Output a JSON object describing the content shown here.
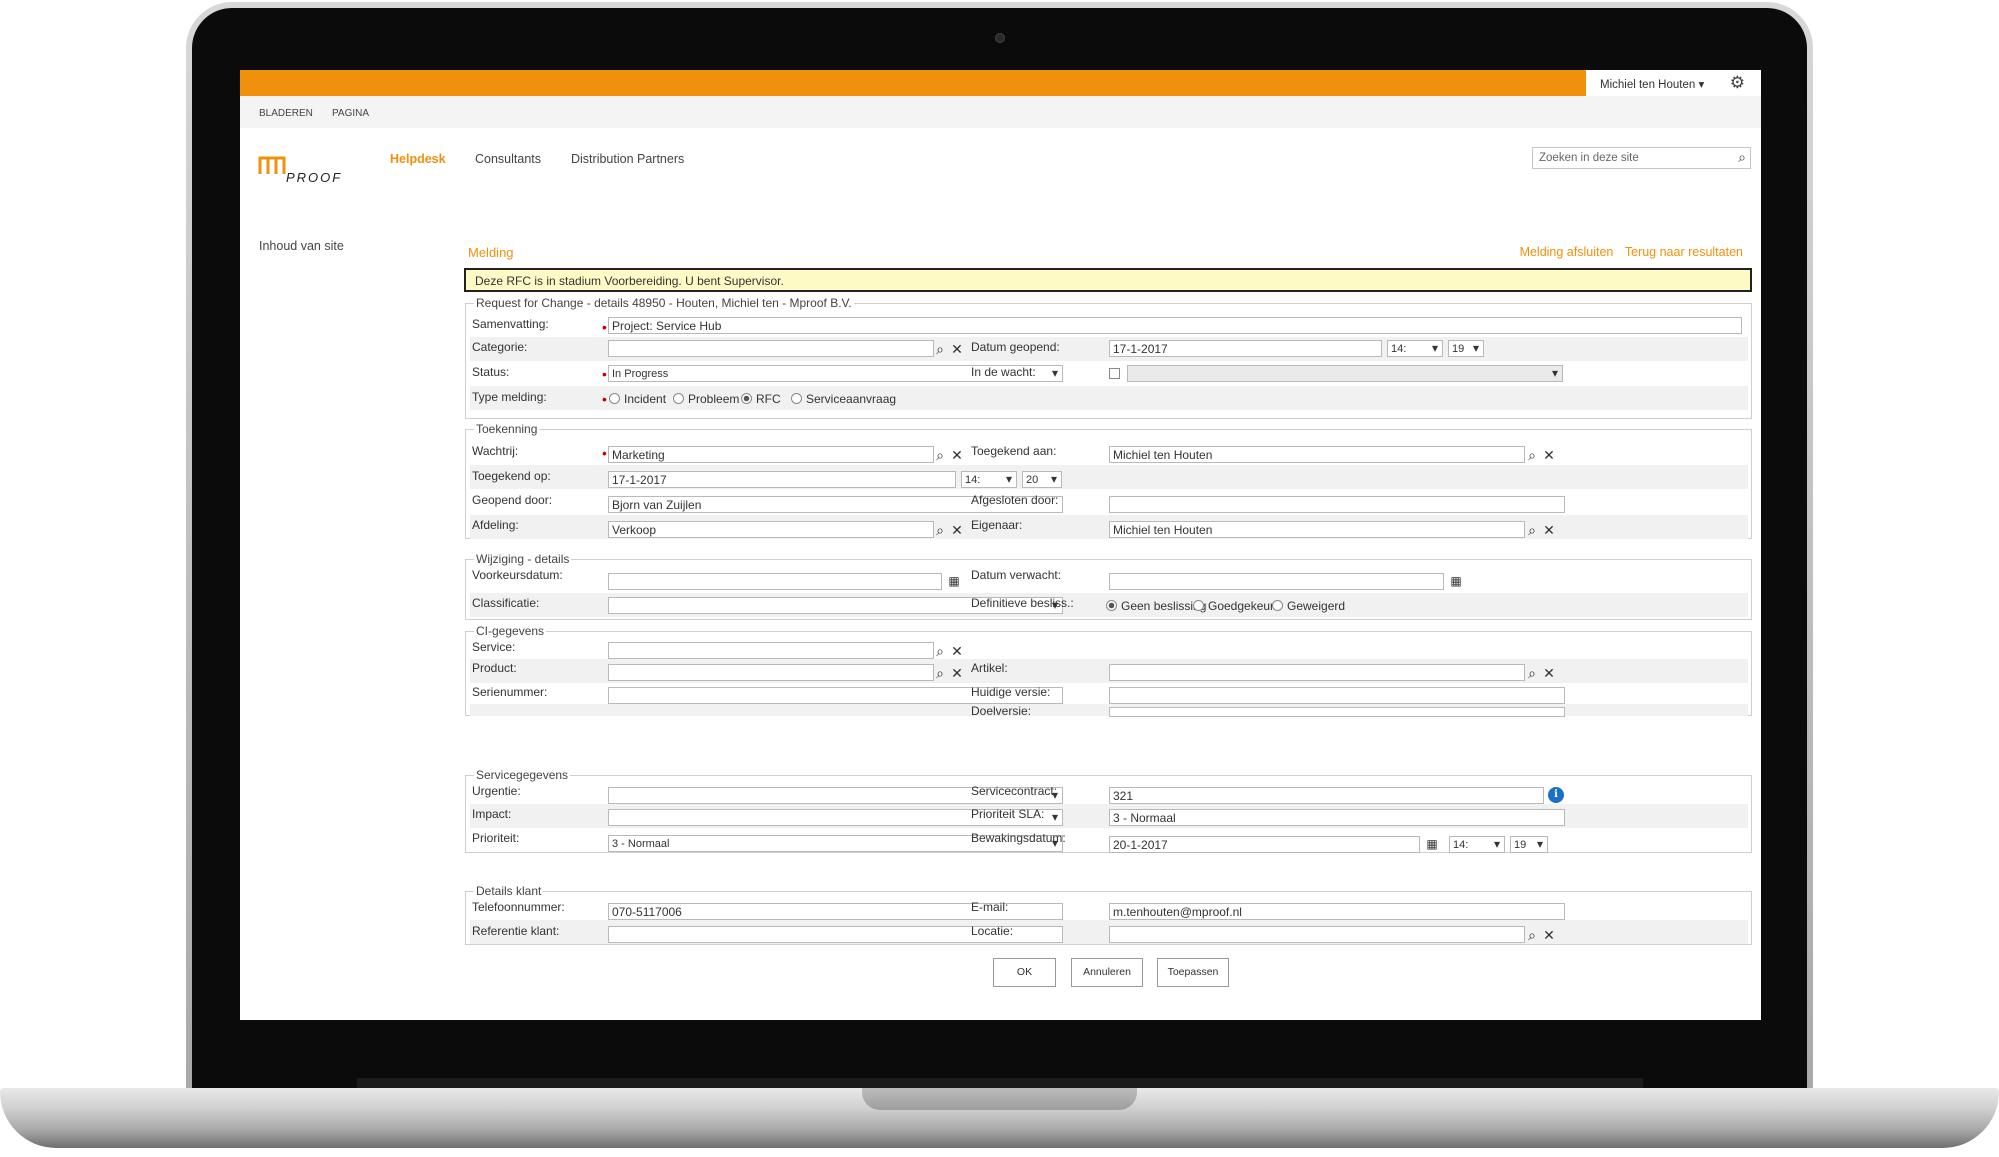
{
  "colors": {
    "accent": "#f0910e",
    "alert_bg": "#fefac6"
  },
  "header": {
    "user": "Michiel ten Houten",
    "user_caret": "▾",
    "gear_icon": "gear-icon",
    "search_placeholder": "Zoeken in deze site"
  },
  "ribbon": {
    "tab1": "BLADEREN",
    "tab2": "PAGINA"
  },
  "nav": {
    "helpdesk": "Helpdesk",
    "consultants": "Consultants",
    "partners": "Distribution Partners"
  },
  "logo": {
    "text": "PROOF"
  },
  "leftnav": {
    "site_contents": "Inhoud van site"
  },
  "page": {
    "breadcrumb": "Melding",
    "close_link": "Melding afsluiten",
    "back_link": "Terug naar resultaten",
    "alert": "Deze RFC is in stadium Voorbereiding. U bent Supervisor."
  },
  "s1": {
    "legend": "Request for Change - details 48950 - Houten, Michiel ten - Mproof B.V.",
    "samenvatting_label": "Samenvatting:",
    "samenvatting": "Project: Service Hub",
    "categorie_label": "Categorie:",
    "categorie": "",
    "datum_label": "Datum geopend:",
    "datum": "17-1-2017",
    "datum_h": "14:",
    "datum_m": "19",
    "status_label": "Status:",
    "status": "In Progress",
    "wacht_label": "In de wacht:",
    "wacht": "",
    "type_label": "Type melding:",
    "types": [
      "Incident",
      "Probleem",
      "RFC",
      "Serviceaanvraag"
    ]
  },
  "s2": {
    "legend": "Toekenning",
    "wachtrij_label": "Wachtrij:",
    "wachtrij": "Marketing",
    "toegekend_aan_label": "Toegekend aan:",
    "toegekend_aan": "Michiel ten Houten",
    "toegekend_op_label": "Toegekend op:",
    "toegekend_op": "17-1-2017",
    "toegekend_h": "14:",
    "toegekend_m": "20",
    "geopend_door_label": "Geopend door:",
    "geopend_door": "Bjorn van Zuijlen",
    "afgesloten_label": "Afgesloten door:",
    "afgesloten": "",
    "afdeling_label": "Afdeling:",
    "afdeling": "Verkoop",
    "eigenaar_label": "Eigenaar:",
    "eigenaar": "Michiel ten Houten"
  },
  "s3": {
    "legend": "Wijziging - details",
    "voorkeur_label": "Voorkeursdatum:",
    "verwacht_label": "Datum verwacht:",
    "classificatie_label": "Classificatie:",
    "besliss_label": "Definitieve besliss.:",
    "beslissingen": [
      "Geen beslissing",
      "Goedgekeurd",
      "Geweigerd"
    ]
  },
  "s4": {
    "legend": "CI-gegevens",
    "service_label": "Service:",
    "product_label": "Product:",
    "artikel_label": "Artikel:",
    "serie_label": "Serienummer:",
    "huidige_label": "Huidige versie:",
    "doel_label": "Doelversie:"
  },
  "s5": {
    "legend": "Servicegegevens",
    "urgentie_label": "Urgentie:",
    "contract_label": "Servicecontract:",
    "contract": "321",
    "impact_label": "Impact:",
    "sla_label": "Prioriteit SLA:",
    "sla": "3 - Normaal",
    "prioriteit_label": "Prioriteit:",
    "prioriteit": "3 - Normaal",
    "bewaking_label": "Bewakingsdatum:",
    "bewaking": "20-1-2017",
    "bewaking_h": "14:",
    "bewaking_m": "19"
  },
  "s6": {
    "legend": "Details klant",
    "telefoon_label": "Telefoonnummer:",
    "telefoon": "070-5117006",
    "email_label": "E-mail:",
    "email": "m.tenhouten@mproof.nl",
    "referentie_label": "Referentie klant:",
    "locatie_label": "Locatie:"
  },
  "buttons": {
    "ok": "OK",
    "cancel": "Annuleren",
    "apply": "Toepassen"
  },
  "icons": {
    "lookup": "🔍",
    "clear": "✕",
    "calendar": "📅"
  }
}
